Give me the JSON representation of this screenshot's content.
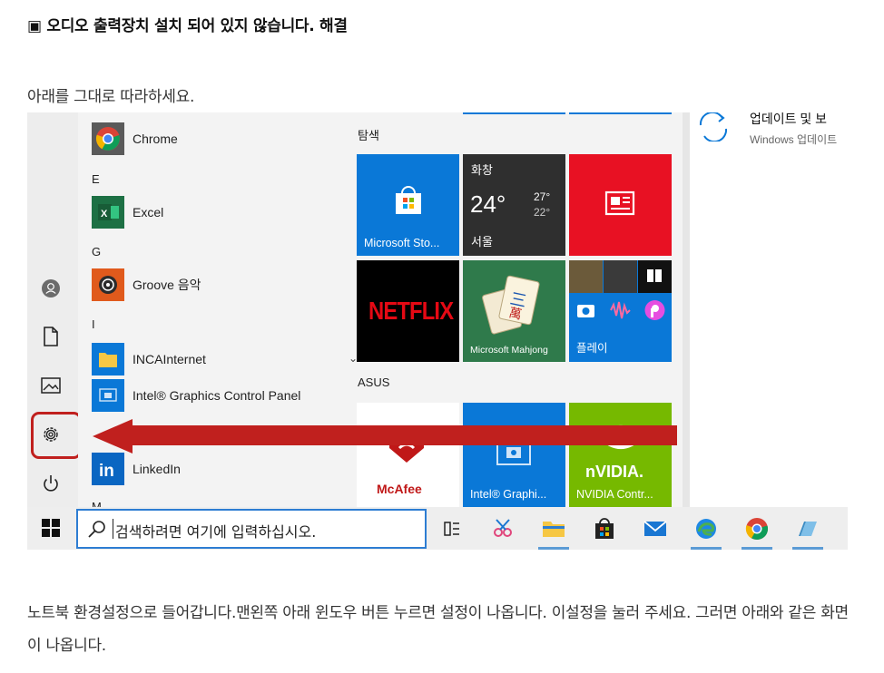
{
  "article": {
    "heading": "▣ 오디오 출력장치 설치 되어 있지 않습니다. 해결",
    "intro": "아래를 그대로 따라하세요.",
    "bottom_text": "노트북 환경설정으로 들어갑니다.맨왼쪽 아래 윈도우 버튼 누르면 설정이 나옵니다. 이설정을 눌러 주세요. 그러면 아래와 같은 화면이 나옵니다."
  },
  "start_menu": {
    "app_list": {
      "chrome": "Chrome",
      "letter_e": "E",
      "excel": "Excel",
      "letter_g": "G",
      "groove": "Groove 음악",
      "letter_i": "I",
      "incainternet": "INCAInternet",
      "intel_graphics": "Intel® Graphics Control Panel",
      "linkedin": "LinkedIn",
      "letter_m": "M"
    },
    "sections": {
      "explore": "탐색",
      "asus": "ASUS"
    },
    "tiles": {
      "store": "Microsoft Sto...",
      "weather_title": "화창",
      "weather_temp": "24°",
      "weather_high": "27°",
      "weather_low": "22°",
      "weather_city": "서울",
      "netflix": "NETFLIX",
      "mahjong": "Microsoft Mahjong",
      "play": "플레이",
      "mcafee": "McAfee",
      "intel_tile": "Intel® Graphi...",
      "nvidia_logo": "nVIDIA.",
      "nvidia": "NVIDIA Contr..."
    },
    "right_panel": {
      "update_title": "업데이트 및 보",
      "update_sub": "Windows 업데이트"
    }
  },
  "taskbar": {
    "search_placeholder": "검색하려면 여기에 입력하십시오."
  },
  "colors": {
    "tile_blue": "#0a78d7",
    "highlight_red": "#c0201e",
    "netflix_red": "#e50914",
    "nvidia_green": "#76b900"
  }
}
